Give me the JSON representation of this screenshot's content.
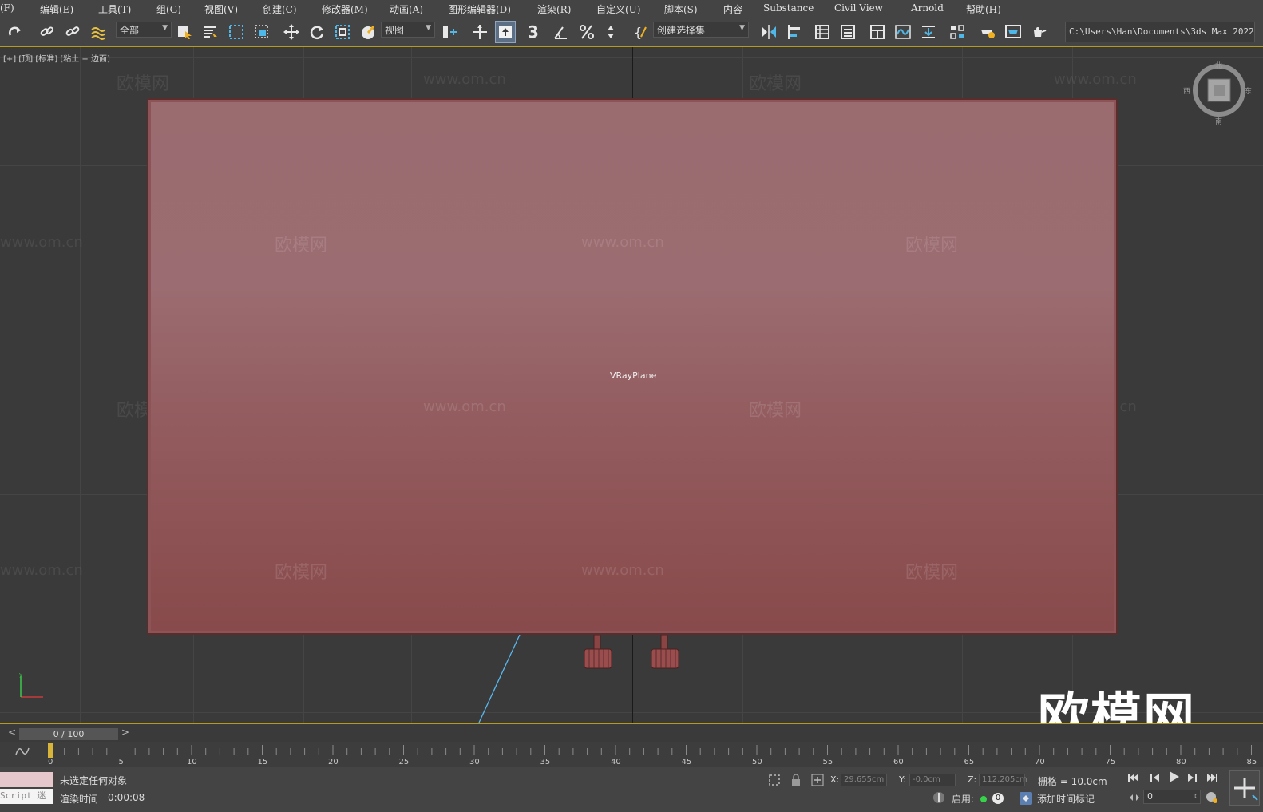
{
  "menu": {
    "items": [
      "(F)",
      "编辑(E)",
      "工具(T)",
      "组(G)",
      "视图(V)",
      "创建(C)",
      "修改器(M)",
      "动画(A)",
      "图形编辑器(D)",
      "渲染(R)",
      "自定义(U)",
      "脚本(S)",
      "内容",
      "Substance",
      "Civil View",
      "Arnold",
      "帮助(H)"
    ]
  },
  "toolbar": {
    "selection_filter": "全部",
    "ref_coord": "视图",
    "named_selection": "创建选择集",
    "project_path": "C:\\Users\\Han\\Documents\\3ds Max 2022",
    "snap_label": "3"
  },
  "viewport": {
    "label": "[+] [顶] [标准] [粘土 + 边面]",
    "object_name": "VRayPlane",
    "plane_color": "#9a6b6f",
    "viewcube": {
      "north": "北",
      "south": "南",
      "east": "东",
      "west": "西"
    },
    "watermarks": [
      "欧模网",
      "www.om.cn"
    ],
    "logo": "欧模网"
  },
  "timeline": {
    "frame_display": "0 / 100",
    "ticks": [
      "0",
      "5",
      "10",
      "15",
      "20",
      "25",
      "30",
      "35",
      "40",
      "45",
      "50",
      "55",
      "60",
      "65",
      "70",
      "75",
      "80",
      "85"
    ]
  },
  "status": {
    "maxscript_label": "Script 迷",
    "selection_msg": "未选定任何对象",
    "render_time_label": "渲染时间",
    "render_time": "0:00:08",
    "x_label": "X:",
    "x_value": "29.655cm",
    "y_label": "Y:",
    "y_value": "-0.0cm",
    "z_label": "Z:",
    "z_value": "112.205cm",
    "grid": "栅格 = 10.0cm",
    "enable_label": "启用:",
    "enable_count": "0",
    "add_time_tag": "添加时间标记",
    "current_frame": "0"
  }
}
